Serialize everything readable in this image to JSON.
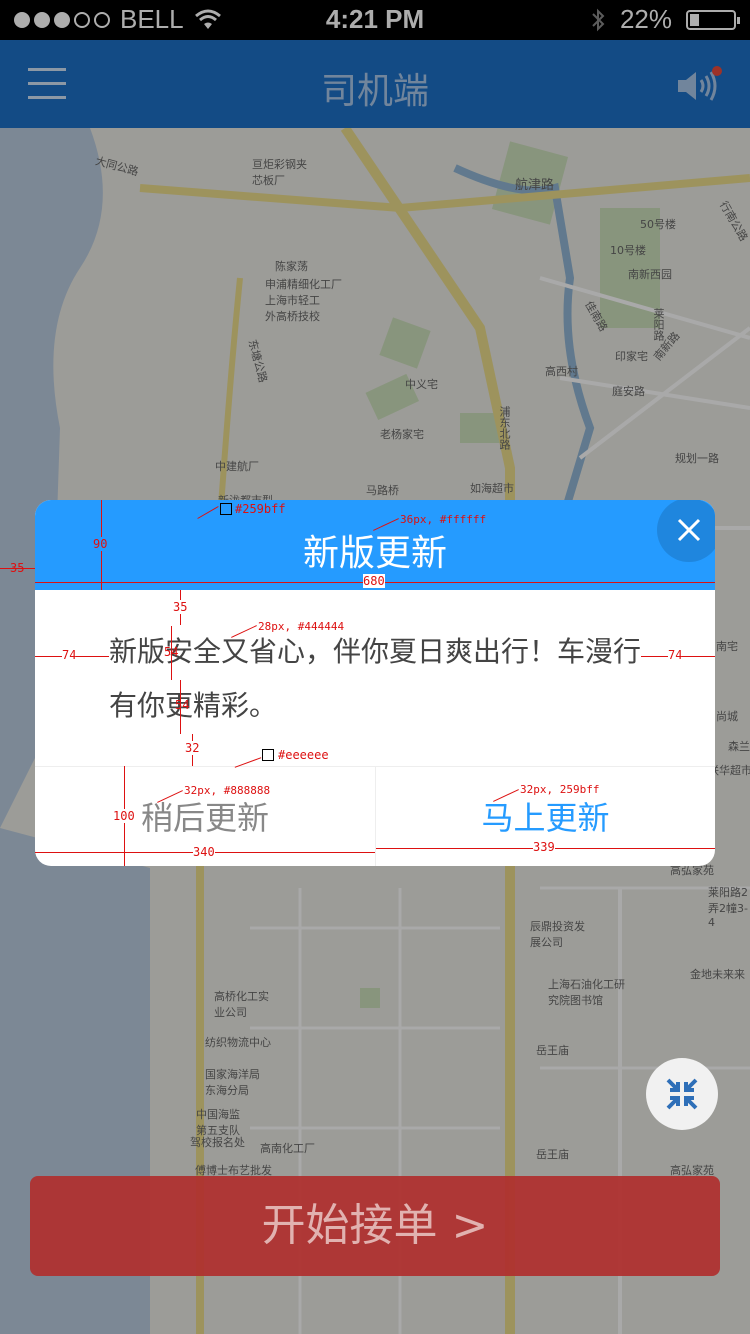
{
  "status_bar": {
    "carrier": "BELL",
    "time": "4:21 PM",
    "battery": "22%",
    "battery_level": 0.22,
    "signal_bars": 3,
    "signal_total": 5
  },
  "nav": {
    "title": "司机端",
    "menu_icon": "menu-icon",
    "speaker_icon": "speaker-icon"
  },
  "map": {
    "labels": {
      "road_dadonggonglu": "大同公路",
      "poi_julu": "亘炬彩钢夹芯板厂",
      "road_hangjin": "航津路",
      "poi_50": "50号楼",
      "poi_10": "10号楼",
      "poi_nanxinxiyuan": "南新西园",
      "road_hangnan": "行南公路",
      "poi_chenjiadang": "陈家荡",
      "poi_shenpu": "申浦精细化工厂",
      "poi_shanghai_light": "上海市轻工外高桥技校",
      "road_dongtang": "东塘公路",
      "road_jiannan": "佳南路",
      "road_laiyang": "莱阳路",
      "poi_yinjiazhai": "印家宅",
      "road_nanxin": "南新路",
      "poi_gaoxicun": "高西村",
      "poi_zhongyizhai": "中义宅",
      "road_tinganlu": "庭安路",
      "poi_laoyangjiazhai": "老杨家宅",
      "road_pudongbei": "浦东北路",
      "road_guihua": "规划一路",
      "poi_zhongjianhangchang": "中建航厂",
      "road_malu": "马路桥",
      "poi_ruhai": "如海超市",
      "poi_xinlong": "新泷都市型",
      "poi_chenchen": "辰鼎投资发展公司",
      "poi_shihua": "上海石油化工研究院图书馆",
      "poi_gaoqiao": "高桥化工实业公司",
      "poi_fangzhi": "纺织物流中心",
      "poi_guojia": "国家海洋局东海分局",
      "poi_haijian": "中国海监第五支队",
      "poi_jiaxiao": "驾校报名处",
      "poi_gaonan": "高南化工厂",
      "poi_yuewang": "岳王庙",
      "poi_yuewang2": "岳王庙",
      "poi_gaohong": "高弘家苑",
      "poi_gaohong2": "高弘家苑",
      "poi_laiyang2": "莱阳路2弄2幢3-4",
      "poi_jindi": "金地未来来",
      "poi_lianhua": "联华超市",
      "poi_sensan": "森兰",
      "poi_shangcheng": "尚城",
      "poi_nanhezhai": "南宅",
      "poi_baishi": "傅博士布艺批发"
    }
  },
  "dialog": {
    "title": "新版更新",
    "close_icon": "close-icon",
    "body": "新版安全又省心，伴你夏日爽出行！车漫行有你更精彩。",
    "later_label": "稍后更新",
    "now_label": "马上更新",
    "header_color": "#259bff",
    "divider_color": "#eeeeee"
  },
  "annotations": {
    "header_color": "#259bff",
    "title_spec": "36px, #ffffff",
    "body_spec": "28px, #444444",
    "divider_color": "#eeeeee",
    "later_spec": "32px, #888888",
    "now_spec": "32px, 259bff",
    "header_height": "90",
    "left_margin": "35",
    "dialog_width": "680",
    "gap_top": "35",
    "padding_left": "74",
    "padding_right": "74",
    "line_height_1": "54",
    "line_height_2": "54",
    "gap_bottom": "32",
    "button_height": "100",
    "button_left_width": "340",
    "button_right_width": "339"
  },
  "start_button": {
    "label": "开始接单  >"
  },
  "locate_icon": "collapse-arrows-icon"
}
